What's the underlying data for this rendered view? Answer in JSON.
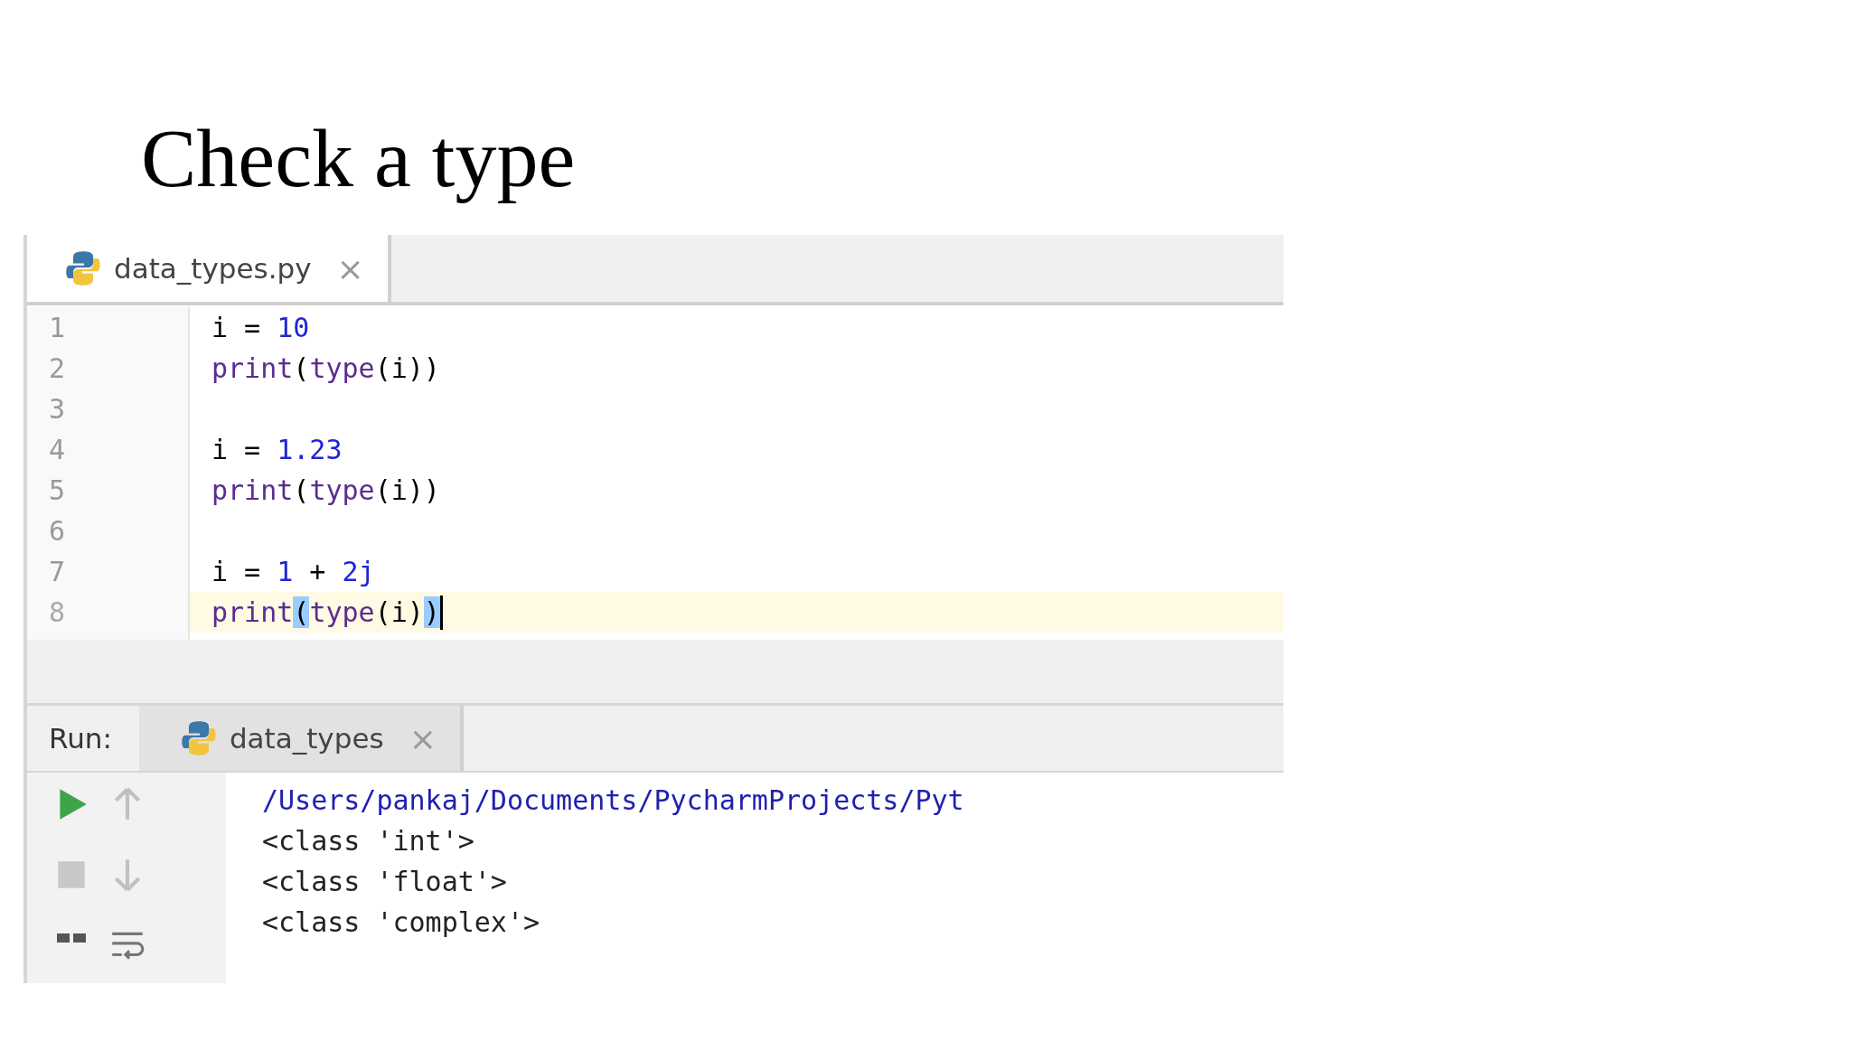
{
  "slide": {
    "title": "Check a type"
  },
  "editor": {
    "tabs": [
      {
        "label": "data_types.py",
        "selected": true,
        "close": "×"
      }
    ],
    "lines": [
      {
        "number": "1",
        "current": false,
        "tokens": [
          {
            "text": "i = ",
            "kind": "plain"
          },
          {
            "text": "10",
            "kind": "number"
          }
        ]
      },
      {
        "number": "2",
        "current": false,
        "tokens": [
          {
            "text": "print",
            "kind": "builtin"
          },
          {
            "text": "(",
            "kind": "plain"
          },
          {
            "text": "type",
            "kind": "builtin"
          },
          {
            "text": "(i))",
            "kind": "plain"
          }
        ]
      },
      {
        "number": "3",
        "current": false
      },
      {
        "number": "4",
        "current": false,
        "tokens": [
          {
            "text": "i = ",
            "kind": "plain"
          },
          {
            "text": "1.23",
            "kind": "number"
          }
        ]
      },
      {
        "number": "5",
        "current": false,
        "tokens": [
          {
            "text": "print",
            "kind": "builtin"
          },
          {
            "text": "(",
            "kind": "plain"
          },
          {
            "text": "type",
            "kind": "builtin"
          },
          {
            "text": "(i))",
            "kind": "plain"
          }
        ]
      },
      {
        "number": "6",
        "current": false
      },
      {
        "number": "7",
        "current": false,
        "tokens": [
          {
            "text": "i = ",
            "kind": "plain"
          },
          {
            "text": "1",
            "kind": "number"
          },
          {
            "text": " + ",
            "kind": "plain"
          },
          {
            "text": "2j",
            "kind": "number"
          }
        ]
      },
      {
        "number": "8",
        "current": true,
        "tokens": [
          {
            "text": "print",
            "kind": "builtin"
          },
          {
            "text": "(",
            "kind": "match"
          },
          {
            "text": "type",
            "kind": "builtin"
          },
          {
            "text": "(i)",
            "kind": "plain"
          },
          {
            "text": ")",
            "kind": "match"
          }
        ]
      }
    ]
  },
  "run": {
    "label": "Run:",
    "tabs": [
      {
        "label": "data_types",
        "selected": true,
        "close": "×"
      }
    ],
    "output": [
      {
        "text": "/Users/pankaj/Documents/PycharmProjects/Pyt",
        "kind": "path"
      },
      {
        "text": "<class 'int'>",
        "kind": "plain"
      },
      {
        "text": "<class 'float'>",
        "kind": "plain"
      },
      {
        "text": "<class 'complex'>",
        "kind": "plain"
      }
    ]
  }
}
